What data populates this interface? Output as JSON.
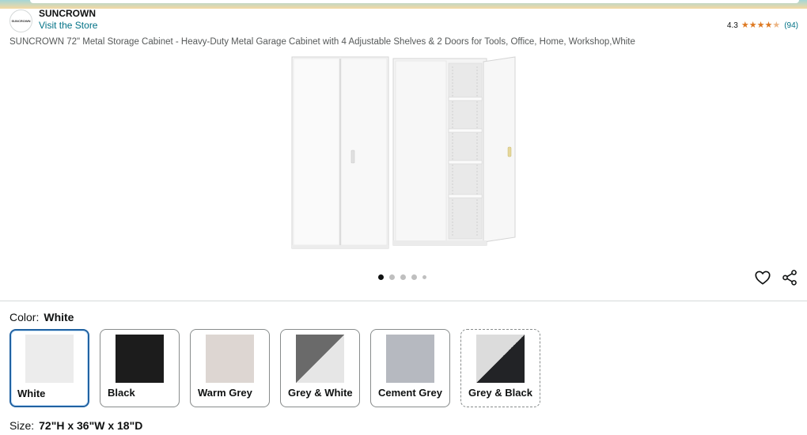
{
  "brand": {
    "logo_text": "SUNCROWN",
    "name": "SUNCROWN",
    "store_link": "Visit the Store"
  },
  "rating": {
    "score": "4.3",
    "stars": 4.3,
    "count": "(94)"
  },
  "product": {
    "title": "SUNCROWN 72\" Metal Storage Cabinet - Heavy-Duty Metal Garage Cabinet with 4 Adjustable Shelves & 2 Doors for Tools, Office, Home, Workshop,White"
  },
  "gallery": {
    "active_index": 0,
    "dot_count": 5
  },
  "actions": {
    "favorite_icon": "heart-icon",
    "share_icon": "share-icon"
  },
  "color": {
    "label": "Color:",
    "selected": "White",
    "options": [
      {
        "name": "White",
        "colors": [
          "#ececec"
        ],
        "selected": true
      },
      {
        "name": "Black",
        "colors": [
          "#1c1c1c"
        ]
      },
      {
        "name": "Warm Grey",
        "colors": [
          "#ddd6d2"
        ]
      },
      {
        "name": "Grey & White",
        "colors": [
          "#6a6a6a",
          "#e6e6e6"
        ]
      },
      {
        "name": "Cement Grey",
        "colors": [
          "#b6b9c0"
        ]
      },
      {
        "name": "Grey & Black",
        "colors": [
          "#dcdcdc",
          "#222326"
        ],
        "dashed": true
      }
    ]
  },
  "size": {
    "label": "Size:",
    "selected": "72\"H x 36\"W x 18\"D"
  },
  "colors": {
    "link": "#007185",
    "star": "#de7921",
    "selected_border": "#2162a1"
  }
}
